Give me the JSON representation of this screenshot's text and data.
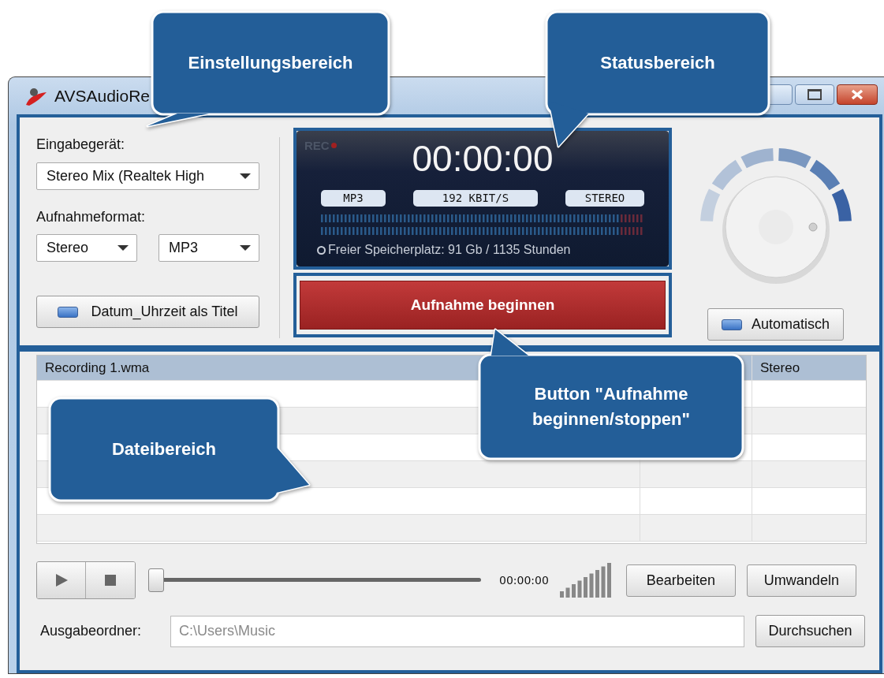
{
  "window": {
    "title": "AVSAudioRe"
  },
  "settings": {
    "input_label": "Eingabegerät:",
    "input_device": "Stereo Mix (Realtek High",
    "format_label": "Aufnahmeformat:",
    "channels": "Stereo",
    "format": "MP3",
    "title_button": "Datum_Uhrzeit als Titel"
  },
  "status": {
    "rec": "REC",
    "time": "00:00:00",
    "badges": [
      "MP3",
      "192 KBIT/S",
      "STEREO"
    ],
    "free_space": "Freier Speicherplatz: 91 Gb / 1135 Stunden"
  },
  "record_button": "Aufnahme beginnen",
  "auto_button": "Automatisch",
  "files": [
    {
      "name": "Recording 1.wma",
      "channels": "Stereo",
      "selected": true
    }
  ],
  "player": {
    "level": 0,
    "time": "00:00:00",
    "buttons": [
      "Bearbeiten",
      "Umwandeln"
    ]
  },
  "output": {
    "label": "Ausgabeordner:",
    "value": "C:\\Users\\Music",
    "browse": "Durchsuchen"
  },
  "callouts": [
    {
      "text": "Einstellungsbereich"
    },
    {
      "text": "Statusbereich"
    },
    {
      "text": "Button \"Aufnahme beginnen/stoppen\""
    },
    {
      "text": "Dateibereich"
    }
  ]
}
